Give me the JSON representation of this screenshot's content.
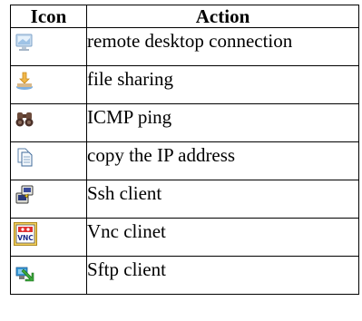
{
  "table": {
    "headers": {
      "icon": "Icon",
      "action": "Action"
    },
    "rows": [
      {
        "icon": "remote-desktop-icon",
        "action": "remote desktop connection"
      },
      {
        "icon": "file-sharing-icon",
        "action": "file sharing"
      },
      {
        "icon": "binoculars-icon",
        "action": "ICMP ping"
      },
      {
        "icon": "copy-document-icon",
        "action": "copy the IP address"
      },
      {
        "icon": "ssh-client-icon",
        "action": "Ssh client"
      },
      {
        "icon": "vnc-icon",
        "action": "Vnc clinet",
        "icon_text": "VNC"
      },
      {
        "icon": "sftp-client-icon",
        "action": "Sftp client"
      }
    ]
  }
}
